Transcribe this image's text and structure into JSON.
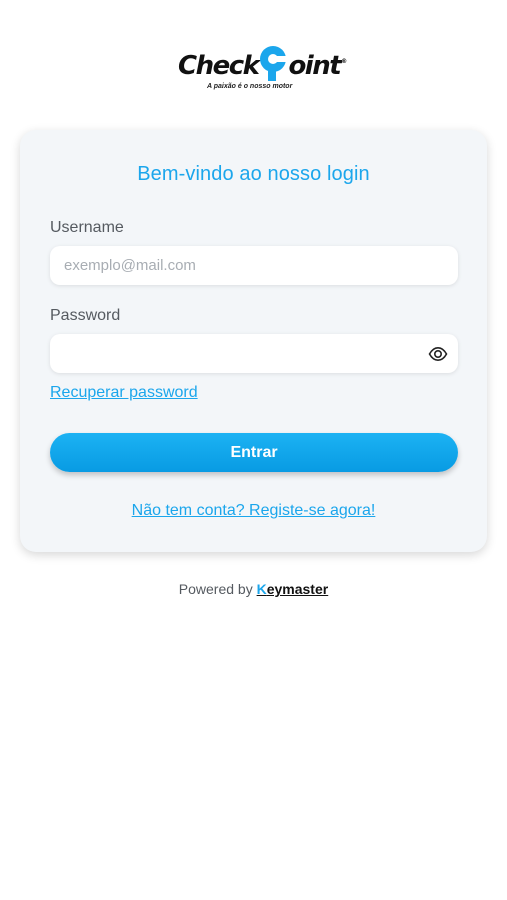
{
  "logo": {
    "brand_before": "Check",
    "brand_after": "oint",
    "registered": "®",
    "tagline": "A paixão é o nosso motor",
    "accent_color": "#1ba6ec"
  },
  "login": {
    "title": "Bem-vindo ao nosso login",
    "username_label": "Username",
    "username_placeholder": "exemplo@mail.com",
    "username_value": "",
    "password_label": "Password",
    "password_value": "",
    "password_toggle_icon": "eye-icon",
    "recover_link": "Recuperar password",
    "submit_label": "Entrar",
    "register_link": "Não tem conta? Registe-se agora!"
  },
  "footer": {
    "powered_by": "Powered by",
    "brand_first": "K",
    "brand_rest": "eymaster"
  },
  "colors": {
    "primary": "#1ba6ec",
    "card_background": "#f3f6f9",
    "text_muted": "#555a60"
  }
}
